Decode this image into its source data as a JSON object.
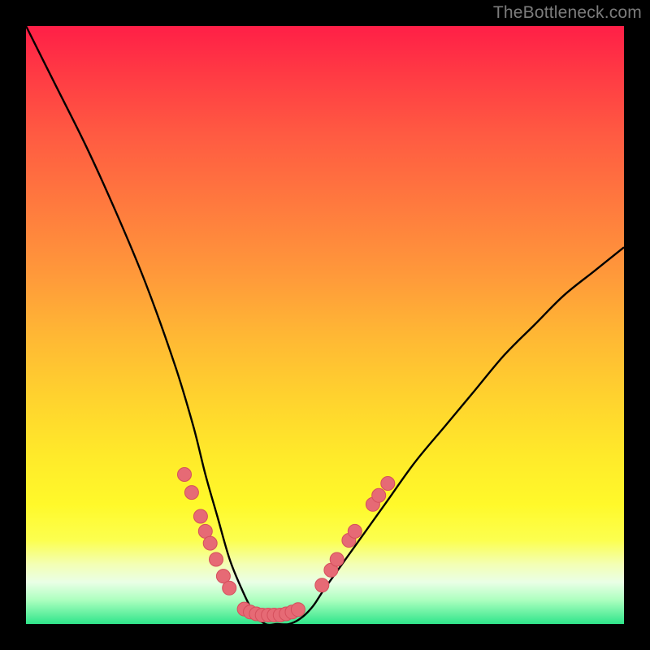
{
  "watermark": "TheBottleneck.com",
  "colors": {
    "frame": "#000000",
    "curve": "#000000",
    "marker": "#e66a75",
    "marker_stroke": "#d54f5c"
  },
  "chart_data": {
    "type": "line",
    "title": "",
    "xlabel": "",
    "ylabel": "",
    "xlim": [
      0,
      100
    ],
    "ylim": [
      0,
      100
    ],
    "grid": false,
    "background_gradient": [
      "#ff1f47",
      "#ffea2a",
      "#2fe58a"
    ],
    "series": [
      {
        "name": "bottleneck-curve",
        "x": [
          0,
          5,
          10,
          15,
          20,
          25,
          28,
          30,
          32,
          34,
          36,
          38,
          40,
          42,
          44,
          46,
          48,
          50,
          55,
          60,
          65,
          70,
          75,
          80,
          85,
          90,
          95,
          100
        ],
        "y": [
          100,
          90,
          80,
          69,
          57,
          43,
          33,
          25,
          18,
          11,
          6,
          2,
          0,
          0,
          0,
          1,
          3,
          6,
          13,
          20,
          27,
          33,
          39,
          45,
          50,
          55,
          59,
          63
        ]
      }
    ],
    "markers": [
      {
        "x": 26.5,
        "y": 25.0
      },
      {
        "x": 27.7,
        "y": 22.0
      },
      {
        "x": 29.2,
        "y": 18.0
      },
      {
        "x": 30.0,
        "y": 15.5
      },
      {
        "x": 30.8,
        "y": 13.5
      },
      {
        "x": 31.8,
        "y": 10.8
      },
      {
        "x": 33.0,
        "y": 8.0
      },
      {
        "x": 34.0,
        "y": 6.0
      },
      {
        "x": 36.5,
        "y": 2.5
      },
      {
        "x": 37.5,
        "y": 2.0
      },
      {
        "x": 38.5,
        "y": 1.7
      },
      {
        "x": 39.5,
        "y": 1.5
      },
      {
        "x": 40.5,
        "y": 1.5
      },
      {
        "x": 41.5,
        "y": 1.5
      },
      {
        "x": 42.5,
        "y": 1.5
      },
      {
        "x": 43.5,
        "y": 1.7
      },
      {
        "x": 44.5,
        "y": 2.0
      },
      {
        "x": 45.5,
        "y": 2.4
      },
      {
        "x": 49.5,
        "y": 6.5
      },
      {
        "x": 51.0,
        "y": 9.0
      },
      {
        "x": 52.0,
        "y": 10.8
      },
      {
        "x": 54.0,
        "y": 14.0
      },
      {
        "x": 55.0,
        "y": 15.5
      },
      {
        "x": 58.0,
        "y": 20.0
      },
      {
        "x": 59.0,
        "y": 21.5
      },
      {
        "x": 60.5,
        "y": 23.5
      }
    ]
  }
}
